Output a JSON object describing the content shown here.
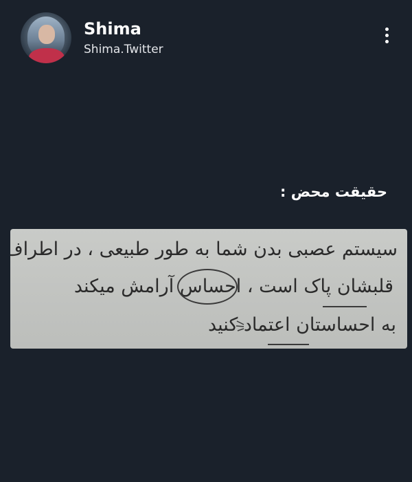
{
  "tweet": {
    "user_name": "Shima",
    "user_handle": "Shima.Twitter",
    "menu_icon": "more-vertical-icon",
    "caption": "حقیقت محض :",
    "image_text": {
      "line1": "سیستم عصبی بدن شما به طور طبیعی ، در اطراف افرادی که",
      "line2": "قلبشان پاک است ، احساس آرامش میکند",
      "line3": "به احساستان اعتماد کنید"
    }
  },
  "colors": {
    "background": "#1a212b",
    "text": "#ffffff",
    "paper": "#c4c6c3"
  }
}
